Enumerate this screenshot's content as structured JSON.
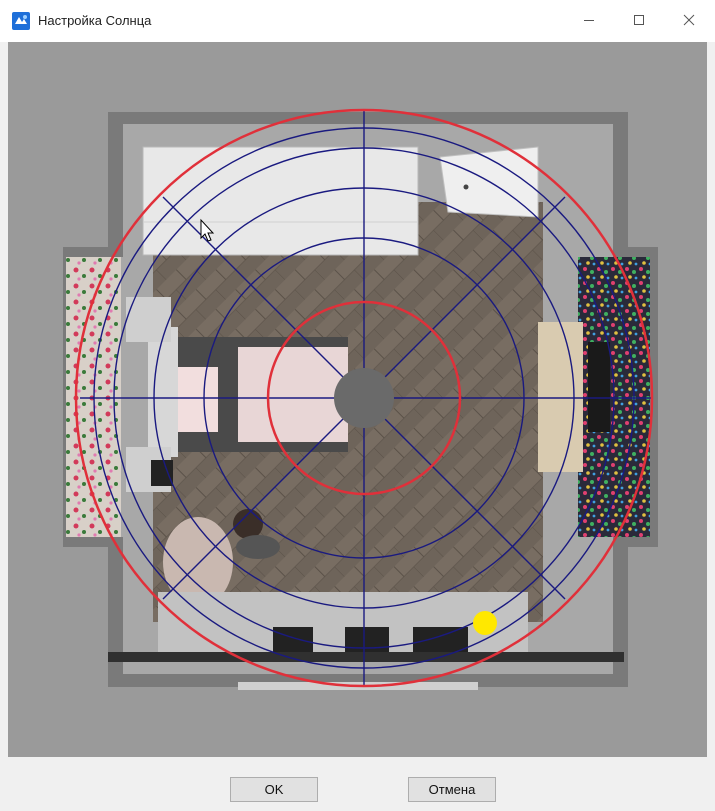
{
  "window": {
    "title": "Настройка Солнца",
    "icon": "app-logo-icon",
    "controls": [
      "minimize-icon",
      "maximize-icon",
      "close-icon"
    ]
  },
  "scene": {
    "description_icon": "top-view-room-render",
    "sun_color": "#ffe800",
    "ring_color": "#e0303a",
    "grid_color": "#1a1a80"
  },
  "buttons": {
    "ok_label": "OK",
    "cancel_label": "Отмена"
  },
  "colors": {
    "title_bar": "#ffffff",
    "canvas_bg": "#9a9a9a",
    "footer_bg": "#f0f0f0"
  }
}
